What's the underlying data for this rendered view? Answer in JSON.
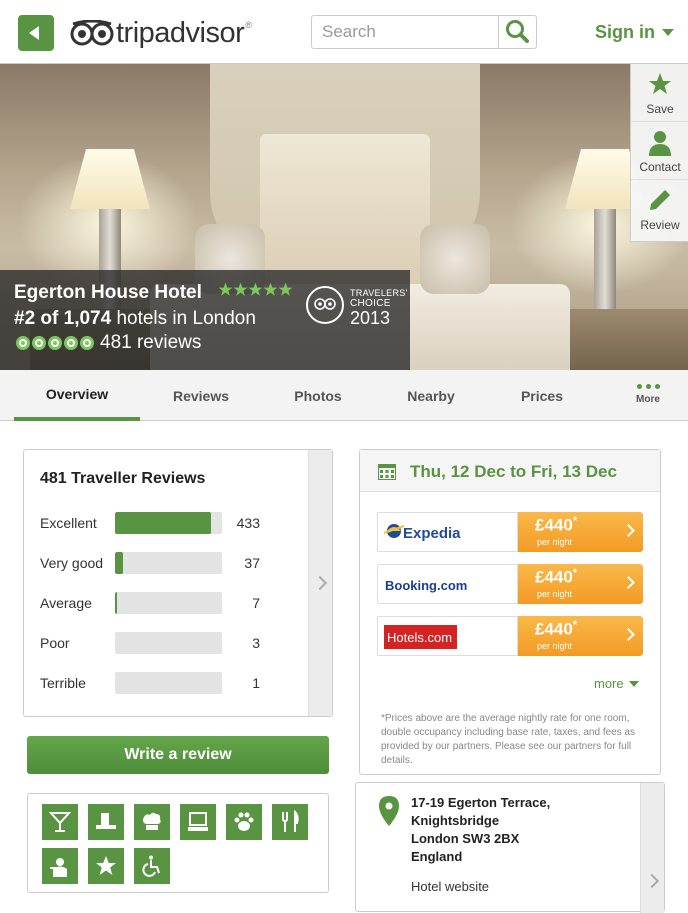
{
  "header": {
    "brand": "tripadvisor",
    "brand_mark": "®",
    "search_placeholder": "Search",
    "sign_in": "Sign in"
  },
  "side_actions": [
    {
      "label": "Save",
      "icon": "star-icon"
    },
    {
      "label": "Contact",
      "icon": "person-icon"
    },
    {
      "label": "Review",
      "icon": "pencil-icon"
    }
  ],
  "hotel": {
    "name": "Egerton House Hotel",
    "rank_prefix": "#2 of 1,074",
    "rank_suffix": " hotels in London",
    "reviews_label": "481 reviews",
    "star_rating": 5,
    "bubble_rating": 5
  },
  "badge": {
    "line1": "TRAVELERS'",
    "line2": "CHOICE",
    "year": "2013",
    "logo_text": "tripadvisor"
  },
  "tabs": [
    {
      "label": "Overview",
      "active": true
    },
    {
      "label": "Reviews"
    },
    {
      "label": "Photos"
    },
    {
      "label": "Nearby"
    },
    {
      "label": "Prices"
    },
    {
      "label": "More"
    }
  ],
  "reviews": {
    "title": "481 Traveller Reviews",
    "rows": [
      {
        "label": "Excellent",
        "count": "433",
        "fraction": 0.9
      },
      {
        "label": "Very good",
        "count": "37",
        "fraction": 0.077
      },
      {
        "label": "Average",
        "count": "7",
        "fraction": 0.015
      },
      {
        "label": "Poor",
        "count": "3",
        "fraction": 0.006
      },
      {
        "label": "Terrible",
        "count": "1",
        "fraction": 0.002
      }
    ]
  },
  "write_review": "Write a review",
  "amenities": [
    {
      "icon": "bar-icon"
    },
    {
      "icon": "concierge-desk-icon"
    },
    {
      "icon": "chef-hat-icon"
    },
    {
      "icon": "computer-icon"
    },
    {
      "icon": "pet-paw-icon"
    },
    {
      "icon": "restaurant-icon"
    },
    {
      "icon": "room-service-icon"
    },
    {
      "icon": "star-icon"
    },
    {
      "icon": "wheelchair-icon"
    }
  ],
  "prices": {
    "date_range": "Thu, 12 Dec to Fri, 13 Dec",
    "providers": [
      {
        "name": "Expedia",
        "price": "£440",
        "per": "per night",
        "asterisk": "*"
      },
      {
        "name": "Booking.com",
        "price": "£440",
        "per": "per night",
        "asterisk": "*"
      },
      {
        "name": "Hotels.com",
        "price": "£440",
        "per": "per night",
        "asterisk": "*"
      }
    ],
    "more": "more",
    "note": "*Prices above are the average nightly rate for one room, double occupancy including base rate, taxes, and fees as provided by our partners. Please see our partners for full details."
  },
  "address": {
    "line1": "17-19 Egerton Terrace,",
    "line2": "Knightsbridge",
    "line3": "London SW3 2BX",
    "line4": "England",
    "website": "Hotel website"
  },
  "colors": {
    "brand_green": "#589442",
    "bubble_green": "#7cc85a",
    "price_orange": "#f5a232",
    "hotels_red": "#d32323"
  }
}
